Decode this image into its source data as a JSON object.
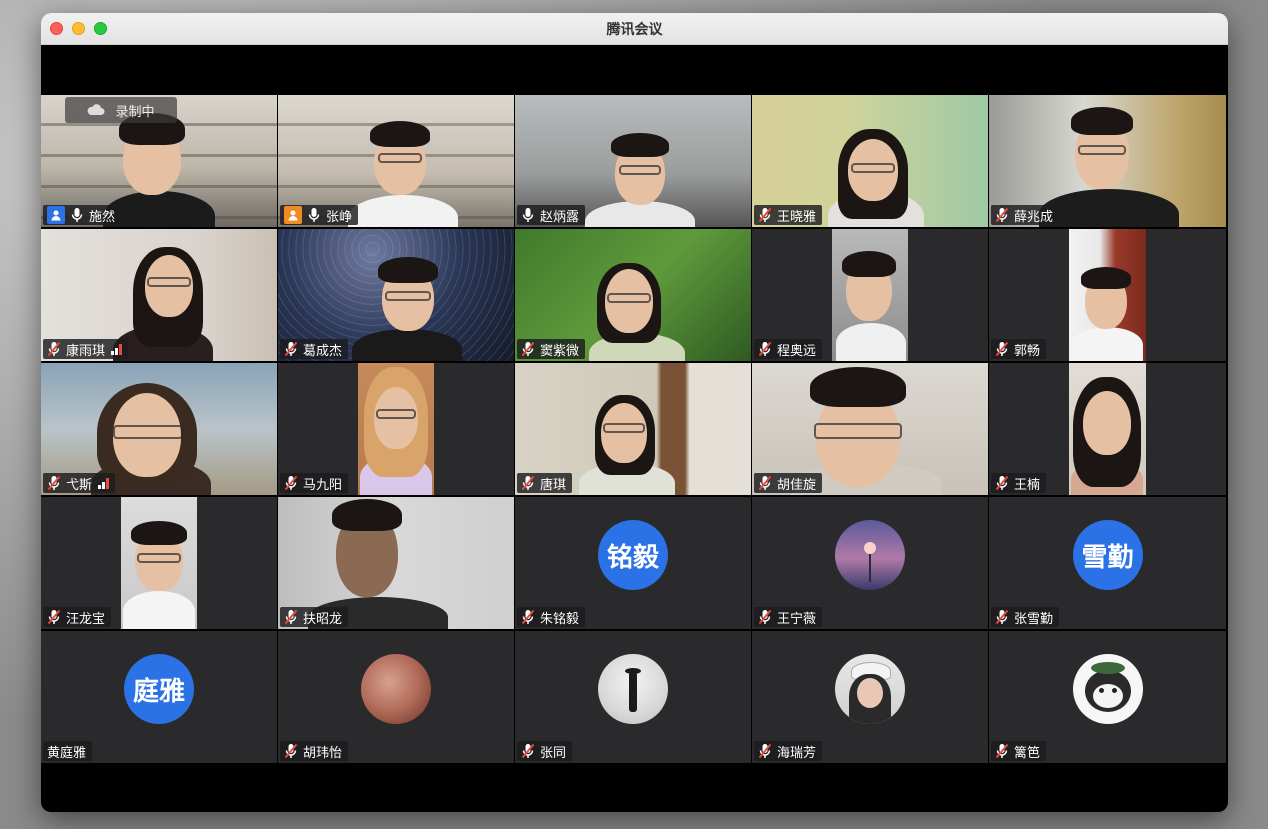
{
  "window": {
    "title": "腾讯会议"
  },
  "recording": {
    "label": "录制中"
  },
  "participants": [
    {
      "name": "施然",
      "mic": "on",
      "role_badge": "host"
    },
    {
      "name": "张峥",
      "mic": "on",
      "role_badge": "cohost"
    },
    {
      "name": "赵炳露",
      "mic": "on"
    },
    {
      "name": "王晓雅",
      "mic": "muted"
    },
    {
      "name": "薛兆成",
      "mic": "muted"
    },
    {
      "name": "康雨琪",
      "mic": "muted",
      "signal": "weak"
    },
    {
      "name": "葛成杰",
      "mic": "muted"
    },
    {
      "name": "窦紫微",
      "mic": "muted"
    },
    {
      "name": "程奥远",
      "mic": "muted"
    },
    {
      "name": "郭畅",
      "mic": "muted"
    },
    {
      "name": "弋斯",
      "mic": "muted",
      "signal": "weak"
    },
    {
      "name": "马九阳",
      "mic": "muted"
    },
    {
      "name": "唐琪",
      "mic": "muted"
    },
    {
      "name": "胡佳旋",
      "mic": "muted"
    },
    {
      "name": "王楠",
      "mic": "muted"
    },
    {
      "name": "汪龙宝",
      "mic": "muted"
    },
    {
      "name": "扶昭龙",
      "mic": "muted"
    },
    {
      "name": "朱铭毅",
      "mic": "muted",
      "avatar_text": "铭毅"
    },
    {
      "name": "王宁薇",
      "mic": "muted"
    },
    {
      "name": "张雪勤",
      "mic": "muted",
      "avatar_text": "雪勤"
    },
    {
      "name": "黄庭雅",
      "mic": "none",
      "avatar_text": "庭雅"
    },
    {
      "name": "胡玮怡",
      "mic": "muted"
    },
    {
      "name": "张同",
      "mic": "muted"
    },
    {
      "name": "海瑞芳",
      "mic": "muted"
    },
    {
      "name": "篱笆",
      "mic": "muted"
    }
  ],
  "colors": {
    "active_speaker_border": "#3cc84a",
    "avatar_blue": "#2b72e6",
    "tile_bg": "#2a2a2c",
    "muted_icon": "#e84a3c",
    "host_badge": "#2b72e6",
    "cohost_badge": "#f08a24"
  }
}
